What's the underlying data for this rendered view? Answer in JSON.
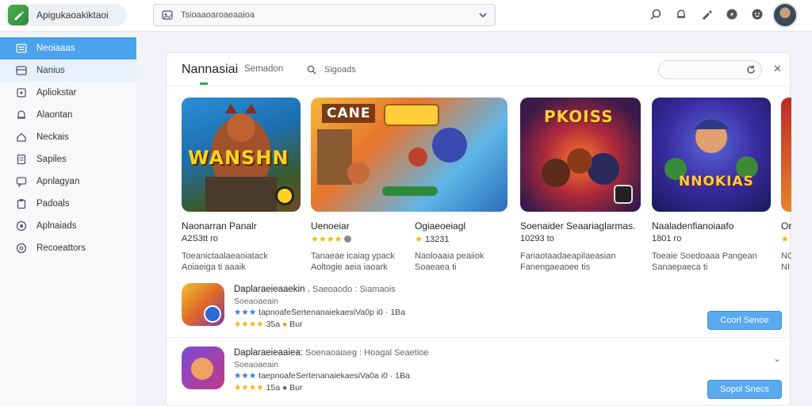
{
  "app": {
    "name": "Apigukaoakiktaoi",
    "logo_icon": "pencil-icon",
    "accent": "#34a853"
  },
  "search": {
    "placeholder": "Tsioaaoaroaeaaioa"
  },
  "top_icons": [
    "search-icon",
    "bell-icon",
    "pen-icon",
    "compass-icon",
    "smiley-icon"
  ],
  "sidebar": {
    "items": [
      {
        "label": "Neoiaaas",
        "icon": "list-icon",
        "state": "active"
      },
      {
        "label": "Nanius",
        "icon": "grid-icon",
        "state": "hover"
      },
      {
        "label": "Apliokstar",
        "icon": "puzzle-icon",
        "state": ""
      },
      {
        "label": "Alaontan",
        "icon": "bell-icon",
        "state": ""
      },
      {
        "label": "Neckais",
        "icon": "home-icon",
        "state": ""
      },
      {
        "label": "Sapiles",
        "icon": "doc-icon",
        "state": ""
      },
      {
        "label": "Apnlagyan",
        "icon": "chat-icon",
        "state": ""
      },
      {
        "label": "Padoals",
        "icon": "clipboard-icon",
        "state": ""
      },
      {
        "label": "Aplnaiads",
        "icon": "target-icon",
        "state": ""
      },
      {
        "label": "Recoeattors",
        "icon": "settings-icon",
        "state": ""
      }
    ]
  },
  "main": {
    "title": "Nannasiai",
    "subtitle": "Semadon",
    "inner_search": "Sigoads",
    "cards": [
      {
        "title": "Naonarran Panalr",
        "rating": "A2S3tt ro",
        "desc1": "Toeanictaalaeaoiatack",
        "desc2": "Aoiaeiga ti aaaik",
        "poster": "WANSHN"
      },
      {
        "title": "Uenoeiar",
        "rating": "★★★★",
        "desc1": "Tanaeae icaiag ypack",
        "desc2": "Aoltogie aeia iaoark",
        "poster": "CANE"
      },
      {
        "title": "Ogiaeoeiagl",
        "rating": "13231",
        "desc1": "Naoloaaia peaiiok",
        "desc2": "Soaeaea ti",
        "poster": "PKOISS"
      },
      {
        "title": "Soenaider Seaariaglarmas.",
        "rating": "10293 to",
        "desc1": "Fanaotaadaeapilaeasian",
        "desc2": "Fanengaeaoee tis",
        "poster": ""
      },
      {
        "title": "Naaladenfianoiaafo",
        "rating": "1801 ro",
        "desc1": "Toeaie Soedoaaa Pangean",
        "desc2": "Sanaepaeca ti",
        "poster": "NNOKIAS"
      },
      {
        "title": "Or",
        "rating": "7",
        "desc1": "NC",
        "desc2": "NI",
        "poster": ""
      }
    ],
    "rows": [
      {
        "title": "Daplaraeieaaekin .",
        "title_sub": "Saeoaodo : Siamaois",
        "line1": "Soeaoaeain",
        "line2": "tapnoafeSertenanaiekaesiVa0p i0 · 1Ba",
        "line3": "35a",
        "line3b": "Bur",
        "button": "Coorl Senoe"
      },
      {
        "title": "Daplaraeieaaiea:",
        "title_sub": "Soenaoaiaeg : Hoagal Seaetioe",
        "line1": "Soeaoaeain",
        "line2": "taepnoafeSertenanaiekaesiVa0a i0 · 1Ba",
        "line3": "15a",
        "line3b": "Bur",
        "button": "Sopol Snecs"
      }
    ]
  }
}
